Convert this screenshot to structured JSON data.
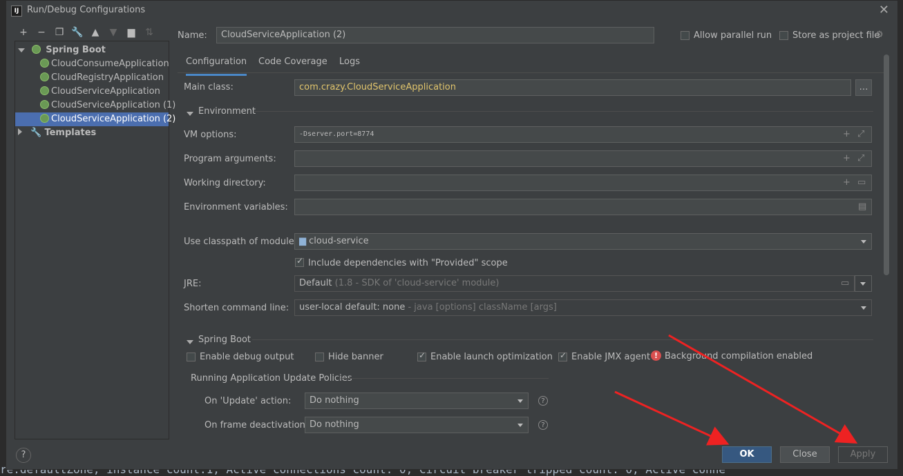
{
  "background": {
    "console_line": "re.defaultZone,    instance count:1,   Active connections count: 0,    Circuit breaker tripped count: 0,   Active conne"
  },
  "dialog": {
    "title": "Run/Debug Configurations",
    "close_icon": "close-icon"
  },
  "toolbar": {
    "icons": [
      "add-icon",
      "remove-icon",
      "copy-icon",
      "wrench-icon",
      "move-up-icon",
      "move-down-icon",
      "folder-icon",
      "sort-icon"
    ]
  },
  "tree": {
    "group": "Spring Boot",
    "items": [
      "CloudConsumeApplication",
      "CloudRegistryApplication",
      "CloudServiceApplication",
      "CloudServiceApplication (1)",
      "CloudServiceApplication (2)"
    ],
    "selected_index": 4,
    "templates": "Templates"
  },
  "header": {
    "name_label": "Name:",
    "name_value": "CloudServiceApplication (2)",
    "allow_parallel": "Allow parallel run",
    "store_project": "Store as project file"
  },
  "tabs": [
    "Configuration",
    "Code Coverage",
    "Logs"
  ],
  "config": {
    "main_class_label": "Main class:",
    "main_class_value": "com.crazy.CloudServiceApplication",
    "environment_section": "Environment",
    "vm_label": "VM options:",
    "vm_value": "-Dserver.port=8774",
    "program_args_label": "Program arguments:",
    "working_dir_label": "Working directory:",
    "env_vars_label": "Environment variables:",
    "classpath_label": "Use classpath of module:",
    "classpath_value": "cloud-service",
    "include_deps": "Include dependencies with \"Provided\" scope",
    "jre_label": "JRE:",
    "jre_value": "Default",
    "jre_hint": "(1.8 - SDK of 'cloud-service' module)",
    "shorten_label": "Shorten command line:",
    "shorten_value": "user-local default: none",
    "shorten_hint": "- java [options] className [args]",
    "springboot_section": "Spring Boot",
    "debug_output": "Enable debug output",
    "hide_banner": "Hide banner",
    "launch_opt": "Enable launch optimization",
    "jmx_agent": "Enable JMX agent",
    "background_compile": "Background compilation enabled",
    "update_policies": "Running Application Update Policies",
    "on_update_label": "On 'Update' action:",
    "on_update_value": "Do nothing",
    "on_frame_label": "On frame deactivation:",
    "on_frame_value": "Do nothing"
  },
  "buttons": {
    "help": "?",
    "ok": "OK",
    "close": "Close",
    "apply": "Apply"
  },
  "colors": {
    "accent_blue": "#4a88c7",
    "selection": "#4b6eaf",
    "main_class_text": "#e0c46c",
    "arrow_red": "#ee2222"
  }
}
